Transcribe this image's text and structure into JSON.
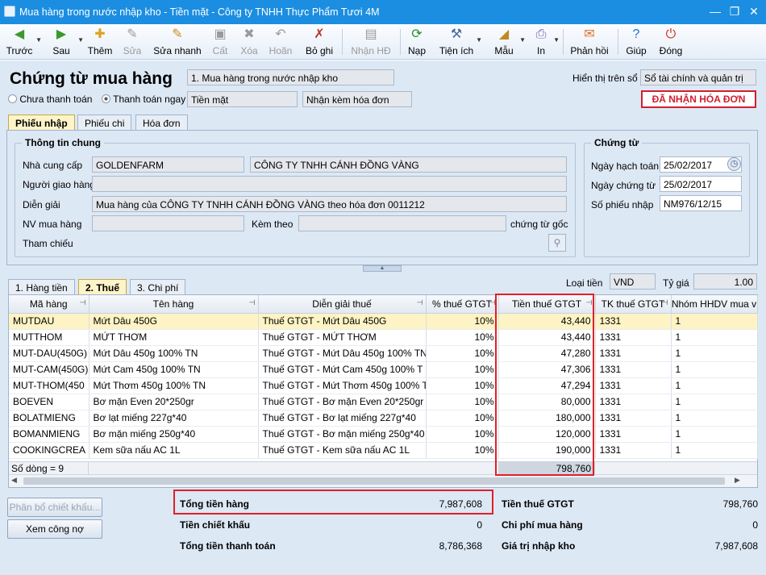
{
  "window": {
    "title": "Mua hàng trong nước nhập kho - Tiền mặt - Công ty TNHH Thực Phẩm Tươi 4M",
    "btn_minimize": "—",
    "btn_restore": "❐",
    "btn_close": "✕"
  },
  "toolbar": {
    "prev": "Trước",
    "next": "Sau",
    "add": "Thêm",
    "edit": "Sửa",
    "quick_edit": "Sửa nhanh",
    "save": "Cất",
    "delete": "Xóa",
    "undo": "Hoãn",
    "unpost": "Bỏ ghi",
    "receive_invoice": "Nhận HĐ",
    "load": "Nạp",
    "utilities": "Tiện ích",
    "template": "Mẫu",
    "print": "In",
    "feedback": "Phản hồi",
    "help": "Giúp",
    "close": "Đóng"
  },
  "header": {
    "heading": "Chứng từ mua hàng",
    "purchase_type": "1. Mua hàng trong nước nhập kho",
    "radio_unpaid": "Chưa thanh toán",
    "radio_paid": "Thanh toán ngay",
    "payment_method": "Tiền mặt",
    "invoice_option": "Nhận kèm hóa đơn",
    "display_label": "Hiển thị trên sổ",
    "display_value": "Sổ tài chính và quản trị",
    "invoice_status": "ĐÃ NHẬN HÓA ĐƠN"
  },
  "tabs_top": [
    "Phiếu nhập",
    "Phiếu chi",
    "Hóa đơn"
  ],
  "general": {
    "legend": "Thông tin chung",
    "supplier_label": "Nhà cung cấp",
    "supplier_code": "GOLDENFARM",
    "supplier_name": "CÔNG TY TNHH CÁNH ĐỒNG VÀNG",
    "deliverer_label": "Người giao hàng",
    "deliverer": "",
    "desc_label": "Diễn giải",
    "desc": "Mua hàng của CÔNG TY TNHH CÁNH ĐỒNG VÀNG theo hóa đơn 0011212",
    "buyer_label": "NV mua hàng",
    "buyer": "",
    "attach_label": "Kèm theo",
    "attach": "",
    "attach_suffix": "chứng từ gốc",
    "ref_label": "Tham chiếu"
  },
  "voucher": {
    "legend": "Chứng từ",
    "posting_date_label": "Ngày hạch toán",
    "posting_date": "25/02/2017",
    "voucher_date_label": "Ngày chứng từ",
    "voucher_date": "25/02/2017",
    "voucher_no_label": "Số phiếu nhập",
    "voucher_no": "NM976/12/15"
  },
  "tabs_grid": [
    "1. Hàng tiền",
    "2. Thuế",
    "3. Chi phí"
  ],
  "currency": {
    "label": "Loại tiền",
    "value": "VND",
    "rate_label": "Tỷ giá",
    "rate": "1.00"
  },
  "grid": {
    "columns": [
      "Mã hàng",
      "Tên hàng",
      "Diễn giải thuế",
      "% thuế GTGT",
      "Tiền thuế GTGT",
      "TK thuế GTGT",
      "Nhóm HHDV mua v"
    ],
    "rows": [
      [
        "MUTDAU",
        "Mứt Dâu  450G",
        "Thuế GTGT - Mứt Dâu  450G",
        "10%",
        "43,440",
        "1331",
        "1"
      ],
      [
        "MUTTHOM",
        "MỨT THƠM",
        "Thuế GTGT - MỨT THƠM",
        "10%",
        "43,440",
        "1331",
        "1"
      ],
      [
        "MUT-DAU(450G)",
        "Mứt Dâu 450g 100% TN",
        "Thuế GTGT - Mứt Dâu 450g 100% TN",
        "10%",
        "47,280",
        "1331",
        "1"
      ],
      [
        "MUT-CAM(450G)",
        "Mứt Cam 450g 100% TN",
        "Thuế GTGT - Mứt Cam 450g 100% T",
        "10%",
        "47,306",
        "1331",
        "1"
      ],
      [
        "MUT-THOM(450",
        "Mứt Thơm 450g 100% TN",
        "Thuế GTGT - Mứt Thơm 450g 100% T",
        "10%",
        "47,294",
        "1331",
        "1"
      ],
      [
        "BOEVEN",
        "Bơ mặn Even 20*250gr",
        "Thuế GTGT - Bơ mặn Even 20*250gr",
        "10%",
        "80,000",
        "1331",
        "1"
      ],
      [
        "BOLATMIENG",
        "Bơ lạt miếng 227g*40",
        "Thuế GTGT - Bơ lạt miếng 227g*40",
        "10%",
        "180,000",
        "1331",
        "1"
      ],
      [
        "BOMANMIENG",
        "Bơ mặn miếng 250g*40",
        "Thuế GTGT - Bơ mặn miếng 250g*40",
        "10%",
        "120,000",
        "1331",
        "1"
      ],
      [
        "COOKINGCREA",
        "Kem sữa nấu AC 1L",
        "Thuế GTGT - Kem sữa nấu AC 1L",
        "10%",
        "190,000",
        "1331",
        "1"
      ]
    ],
    "row_count": "Số dòng = 9",
    "tax_total": "798,760"
  },
  "buttons": {
    "allocate_discount": "Phân bổ chiết khấu...",
    "view_debt": "Xem công nợ"
  },
  "summary": {
    "goods_label": "Tổng tiền hàng",
    "goods": "7,987,608",
    "discount_label": "Tiền chiết khấu",
    "discount": "0",
    "payment_label": "Tổng tiền thanh toán",
    "payment": "8,786,368",
    "vat_label": "Tiền thuế GTGT",
    "vat": "798,760",
    "cost_label": "Chi phí mua hàng",
    "cost": "0",
    "import_label": "Giá trị nhập kho",
    "import": "7,987,608"
  },
  "colors": {
    "titlebar": "#1b8ee1",
    "panel": "#dde8f5",
    "highlight": "#e0202a",
    "selected_row": "#fdf3c4"
  }
}
